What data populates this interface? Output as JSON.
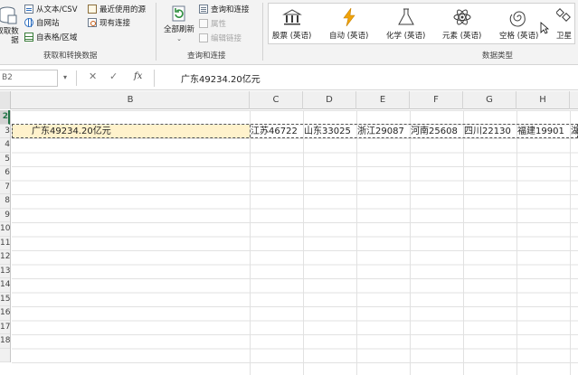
{
  "ribbon": {
    "get_transform": {
      "get_data_label": "取取数\n据",
      "from_text_csv": "从文本/CSV",
      "from_web": "自网站",
      "from_table_range": "自表格/区域",
      "recent_sources": "最近使用的源",
      "existing_connections": "现有连接",
      "group_label": "获取和转换数据"
    },
    "queries": {
      "refresh_all": "全部刷新",
      "queries_connections": "查询和连接",
      "properties": "属性",
      "edit_links": "编辑链接",
      "group_label": "查询和连接"
    },
    "data_types": {
      "items": [
        {
          "label": "股票 (英语)",
          "icon": "bank-icon"
        },
        {
          "label": "自动 (英语)",
          "icon": "lightning-icon"
        },
        {
          "label": "化学 (英语)",
          "icon": "flask-icon"
        },
        {
          "label": "元素 (英语)",
          "icon": "atom-icon"
        },
        {
          "label": "空格 (英语)",
          "icon": "galaxy-icon"
        },
        {
          "label": "卫星",
          "icon": "satellite-icon"
        }
      ],
      "group_label": "数据类型"
    }
  },
  "formula_bar": {
    "name_box": "B2",
    "formula": "广东49234.20亿元"
  },
  "columns": [
    "B",
    "C",
    "D",
    "E",
    "F",
    "G",
    "H"
  ],
  "rows": [
    "2",
    "3",
    "4",
    "5",
    "6",
    "7",
    "8",
    "9",
    "10",
    "11",
    "12",
    "13",
    "14",
    "15",
    "16",
    "17",
    "18"
  ],
  "row2_cells": {
    "B": "广东49234.20亿元",
    "C": "江苏46722",
    "D": "山东33025",
    "E": "浙江29087",
    "F": "河南25608",
    "G": "四川22130",
    "H": "福建19901",
    "I": "湖"
  },
  "colors": {
    "selected_cell_fill": "#fff2cc",
    "active_row_accent": "#217346",
    "lightning": "#f0a30a"
  }
}
